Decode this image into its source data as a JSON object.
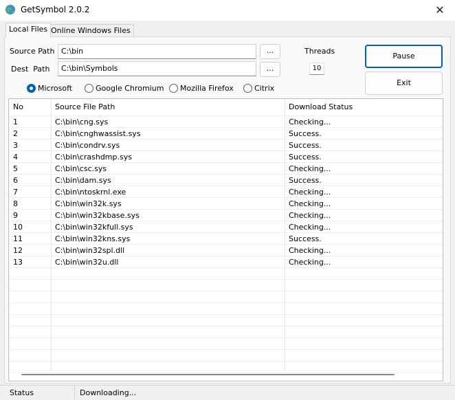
{
  "window": {
    "title": "GetSymbol 2.0.2",
    "app_icon": "globe-icon",
    "close_glyph": "✕"
  },
  "tabs": [
    {
      "label": "Local Files",
      "active": true
    },
    {
      "label": "Online Windows Files",
      "active": false
    }
  ],
  "form": {
    "source_path_label": "Source Path",
    "source_path_value": "C:\\bin",
    "dest_path_label": "Dest  Path",
    "dest_path_value": "C:\\bin\\Symbols",
    "browse_label": "...",
    "threads_label": "Threads",
    "threads_value": "10"
  },
  "buttons": {
    "pause": "Pause",
    "exit": "Exit"
  },
  "symbol_servers": {
    "selected": "Microsoft",
    "options": [
      "Microsoft",
      "Google Chromium",
      "Mozilla Firefox",
      "Citrix"
    ]
  },
  "table": {
    "columns": [
      "No",
      "Source File Path",
      "Download Status"
    ],
    "rows": [
      [
        "1",
        "C:\\bin\\cng.sys",
        "Checking..."
      ],
      [
        "2",
        "C:\\bin\\cnghwassist.sys",
        "Success."
      ],
      [
        "3",
        "C:\\bin\\condrv.sys",
        "Success."
      ],
      [
        "4",
        "C:\\bin\\crashdmp.sys",
        "Success."
      ],
      [
        "5",
        "C:\\bin\\csc.sys",
        "Checking..."
      ],
      [
        "6",
        "C:\\bin\\dam.sys",
        "Success."
      ],
      [
        "7",
        "C:\\bin\\ntoskrnl.exe",
        "Checking..."
      ],
      [
        "8",
        "C:\\bin\\win32k.sys",
        "Checking..."
      ],
      [
        "9",
        "C:\\bin\\win32kbase.sys",
        "Checking..."
      ],
      [
        "10",
        "C:\\bin\\win32kfull.sys",
        "Checking..."
      ],
      [
        "11",
        "C:\\bin\\win32kns.sys",
        "Success."
      ],
      [
        "12",
        "C:\\bin\\win32spl.dll",
        "Checking..."
      ],
      [
        "13",
        "C:\\bin\\win32u.dll",
        "Checking..."
      ]
    ]
  },
  "statusbar": {
    "label": "Status",
    "text": "Downloading..."
  },
  "colors": {
    "accent": "#005fb8",
    "window_bg": "#f0f0f0"
  }
}
